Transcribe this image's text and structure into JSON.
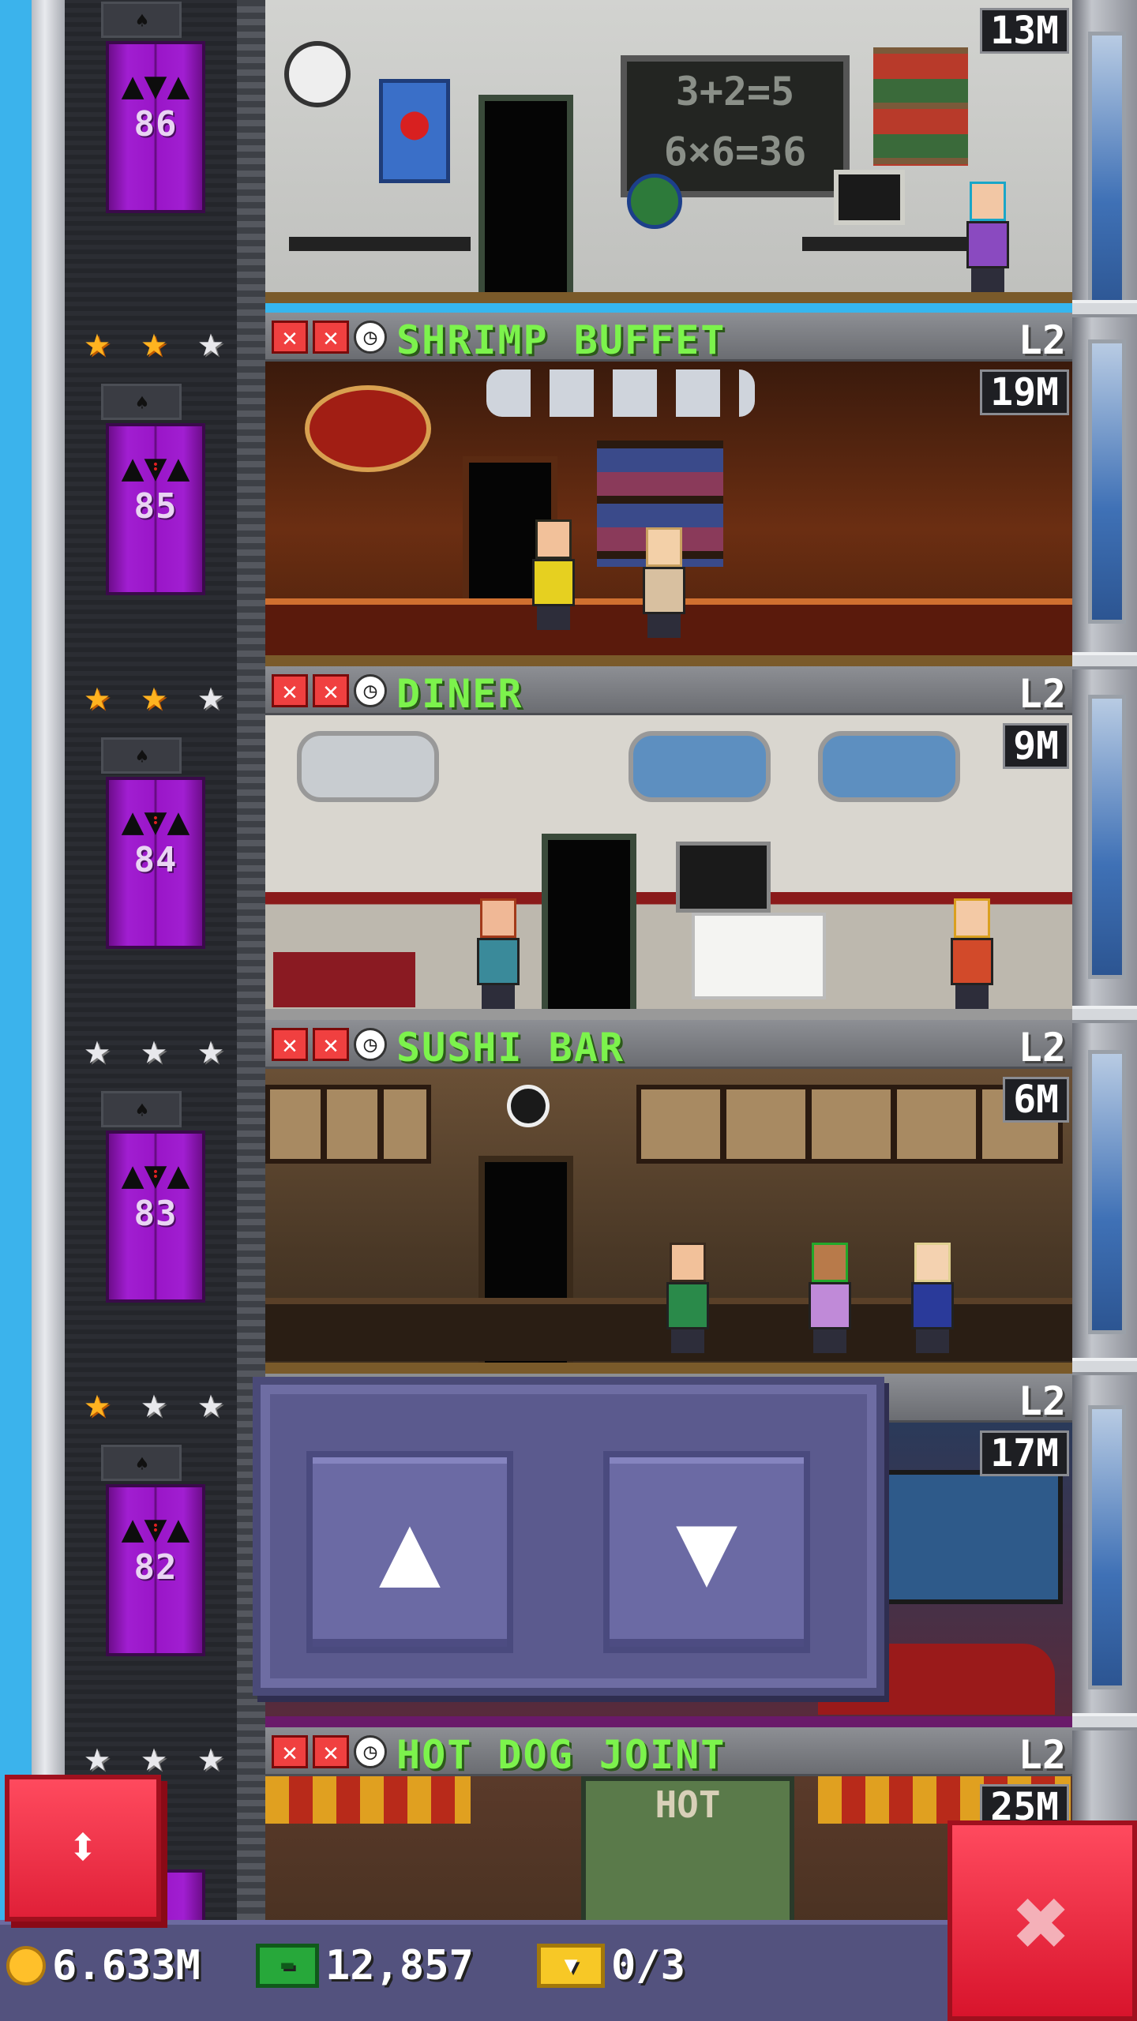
{
  "top_floor": {
    "money": "13M",
    "elevator_number": "86",
    "chalkboard_line1": "3+2=5",
    "chalkboard_line2": "6×6=36"
  },
  "floors": [
    {
      "elevator_number": "85",
      "name": "SHRIMP BUFFET",
      "level": "L2",
      "money": "19M",
      "stars": [
        "gold",
        "gold",
        "silver"
      ]
    },
    {
      "elevator_number": "84",
      "name": "DINER",
      "level": "L2",
      "money": "9M",
      "stars": [
        "gold",
        "gold",
        "silver"
      ]
    },
    {
      "elevator_number": "83",
      "name": "SUSHI BAR",
      "level": "L2",
      "money": "6M",
      "stars": [
        "silver",
        "silver",
        "silver"
      ]
    },
    {
      "elevator_number": "82",
      "name": "",
      "level": "L2",
      "money": "17M",
      "stars": [
        "gold",
        "silver",
        "silver"
      ]
    },
    {
      "elevator_number": "",
      "name": "HOT DOG JOINT",
      "level": "L2",
      "money": "25M",
      "sign": "HOT",
      "stars": [
        "silver",
        "silver",
        "silver"
      ]
    }
  ],
  "hud": {
    "coins": "6.633M",
    "bux": "12,857",
    "tickets": "0/3"
  },
  "icons": {
    "star": "★",
    "x": "✕",
    "clock": "◷",
    "up": "▲",
    "down": "▼",
    "elevator": "⬍",
    "close": "✖"
  },
  "colors": {
    "room_name": "#7cf34c",
    "elevator_door": "#9a16c8",
    "bottom_bar": "#53527e",
    "close_button": "#e02038"
  }
}
